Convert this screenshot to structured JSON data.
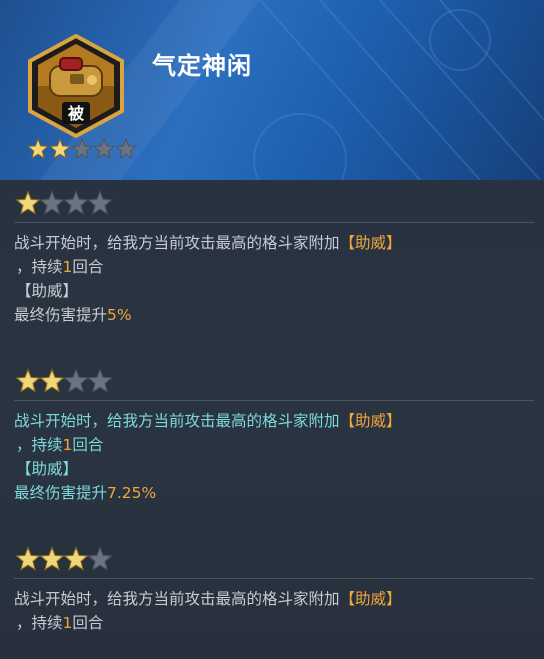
{
  "skill": {
    "title": "气定神闲",
    "icon_badge": "被",
    "icon": "backpack-icon",
    "header_stars": {
      "filled": 2,
      "total": 5
    }
  },
  "tiers": [
    {
      "stars": {
        "filled": 1,
        "total": 4
      },
      "active": false,
      "line1": "战斗开始时，给我方当前攻击最高的格斗家附加",
      "buff_tag": "【助威】",
      "line2_pre": "，持续",
      "line2_num": "1",
      "line2_post": "回合",
      "buff_name": "【助威】",
      "effect_text": "最终伤害提升",
      "effect_value": "5%"
    },
    {
      "stars": {
        "filled": 2,
        "total": 4
      },
      "active": true,
      "line1": "战斗开始时，给我方当前攻击最高的格斗家附加",
      "buff_tag": "【助威】",
      "line2_pre": "，持续",
      "line2_num": "1",
      "line2_post": "回合",
      "buff_name": "【助威】",
      "effect_text": "最终伤害提升",
      "effect_value": "7.25%"
    },
    {
      "stars": {
        "filled": 3,
        "total": 4
      },
      "active": false,
      "line1": "战斗开始时，给我方当前攻击最高的格斗家附加",
      "buff_tag": "【助威】",
      "line2_pre": "，持续",
      "line2_num": "1",
      "line2_post": "回合"
    }
  ],
  "colors": {
    "star_filled": "#f2d77a",
    "star_empty": "#6b7480",
    "highlight": "#f0a63a",
    "active_text": "#7ed9d9",
    "inactive_text": "#c7ccd3"
  }
}
